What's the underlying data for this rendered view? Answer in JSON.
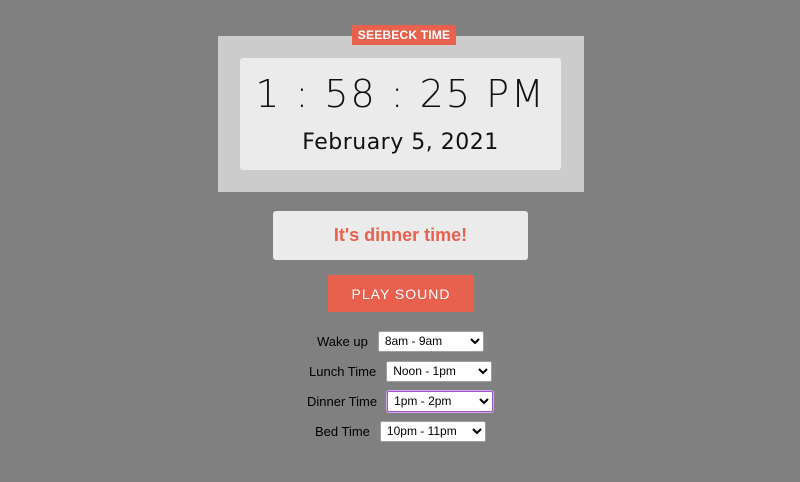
{
  "clock": {
    "badge": "SEEBECK TIME",
    "time": "1 : 58 : 25 PM",
    "date": "February 5, 2021"
  },
  "message": "It's dinner time!",
  "play_button": "PLAY SOUND",
  "schedule": [
    {
      "label": "Wake up",
      "value": "8am - 9am"
    },
    {
      "label": "Lunch Time",
      "value": "Noon - 1pm"
    },
    {
      "label": "Dinner Time",
      "value": "1pm - 2pm"
    },
    {
      "label": "Bed Time",
      "value": "10pm - 11pm"
    }
  ],
  "colors": {
    "accent": "#e8614f",
    "background": "#808080",
    "frame": "#cccccc",
    "panel": "#ebebeb"
  }
}
